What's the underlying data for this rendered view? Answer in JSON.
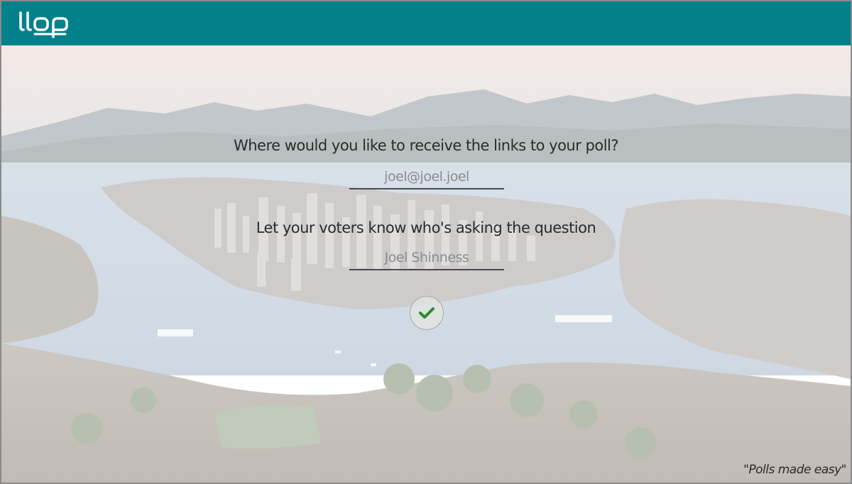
{
  "header": {
    "logo_text": "llop",
    "accent_color": "#02818a"
  },
  "form": {
    "email_question": "Where would you like to receive the links to your poll?",
    "email_value": "joel@joel.joel",
    "name_question": "Let your voters know who's asking the question",
    "name_value": "Joel Shinness",
    "submit_icon": "checkmark-icon",
    "submit_color": "#2e8b2e"
  },
  "footer": {
    "tagline": "\"Polls made easy\""
  },
  "background": {
    "description_icon": "city-skyline-image"
  }
}
